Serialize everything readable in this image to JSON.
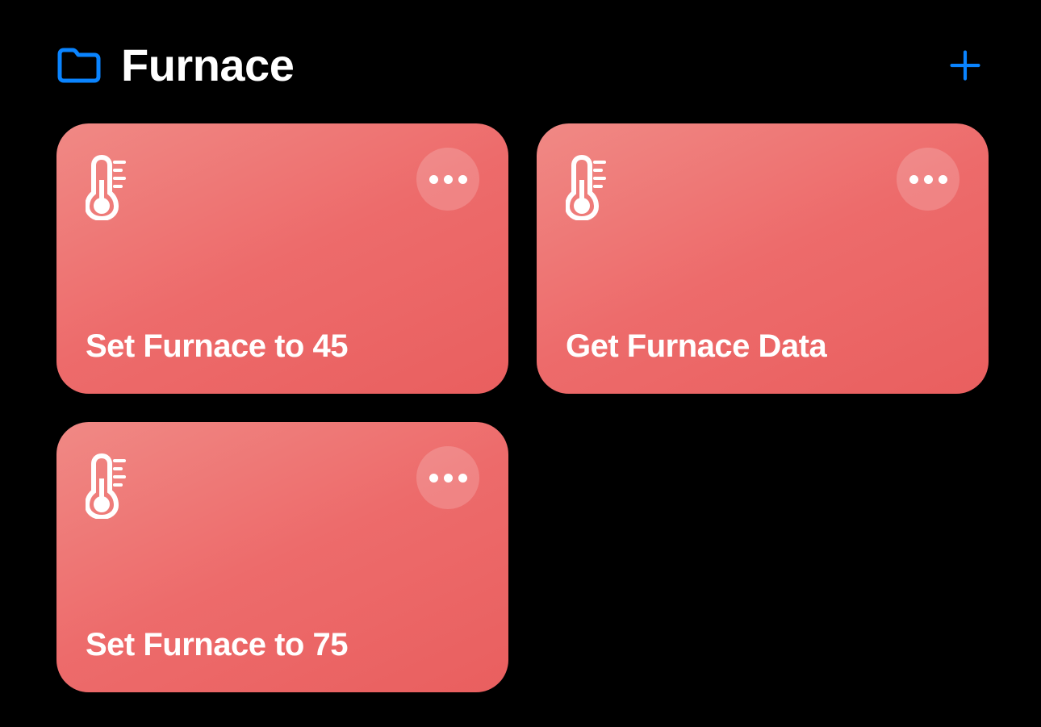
{
  "header": {
    "title": "Furnace"
  },
  "colors": {
    "accent": "#0a84ff",
    "card_start": "#f08985",
    "card_end": "#e95f5f"
  },
  "shortcuts": [
    {
      "label": "Set Furnace to 45",
      "icon": "thermometer-icon"
    },
    {
      "label": "Get Furnace Data",
      "icon": "thermometer-icon"
    },
    {
      "label": "Set Furnace to 75",
      "icon": "thermometer-icon"
    }
  ]
}
